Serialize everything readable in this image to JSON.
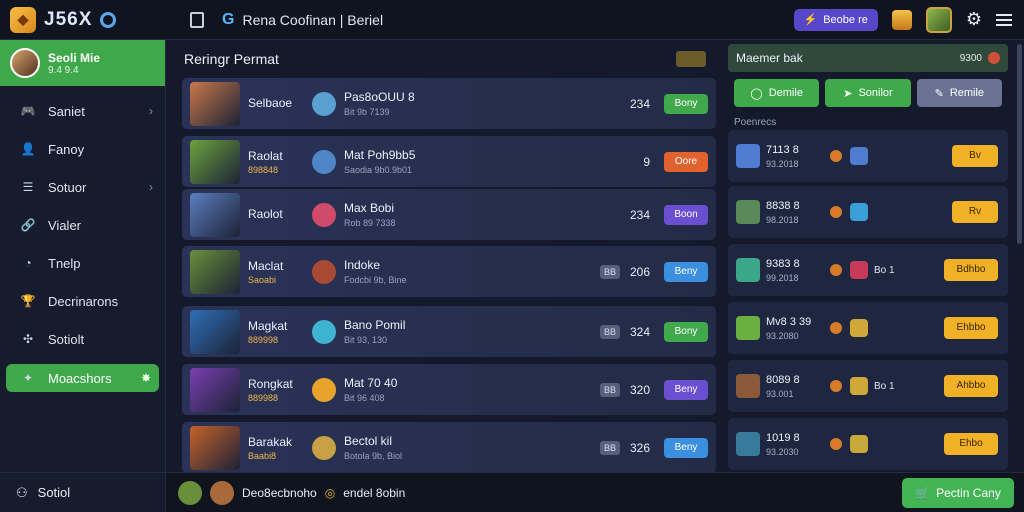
{
  "app": {
    "logo_text": "J56X",
    "breadcrumb": "Rena Coofinan | Beriel"
  },
  "topbar": {
    "promo_label": "Beobe re"
  },
  "profile": {
    "name": "Seoli Mie",
    "sub": "9.4 9.4"
  },
  "sidebar": {
    "items": [
      {
        "label": "Saniet",
        "icon": "controller-icon",
        "chevron": true
      },
      {
        "label": "Fanoy",
        "icon": "user-icon",
        "chevron": false
      },
      {
        "label": "Sotuor",
        "icon": "list-icon",
        "chevron": true
      },
      {
        "label": "Vialer",
        "icon": "link-icon",
        "chevron": false
      },
      {
        "label": "Tnelp",
        "icon": "clock-icon",
        "chevron": false
      },
      {
        "label": "Decrinarons",
        "icon": "trophy-icon",
        "chevron": false
      },
      {
        "label": "Sotiolt",
        "icon": "target-icon",
        "chevron": false
      },
      {
        "label": "Moacshors",
        "icon": "sparkle-icon",
        "chevron": false,
        "active": true
      }
    ],
    "bottom_label": "Sotiol"
  },
  "main": {
    "title": "Reringr Permat",
    "rows": [
      {
        "name": "Selbaoe",
        "tag": "",
        "desc": "Pas8oOUU 8",
        "desc_sub": "Bit 9b 7139",
        "num": "234",
        "btn": "Bony",
        "btn_color": "#3fa94c",
        "av1": "#c9784a",
        "av2": "#5aa0d0",
        "cb": ""
      },
      {
        "name": "Raolat",
        "tag": "898848",
        "desc": "Mat Poh9bb5",
        "desc_sub": "Saodia 9b0.9b01",
        "num": "9",
        "btn": "Oore",
        "btn_color": "#e0622e",
        "av1": "#6ba23c",
        "av2": "#4e86c8",
        "cb": ""
      },
      {
        "name": "Raolot",
        "tag": "",
        "desc": "Max Bobi",
        "desc_sub": "Rob 89 7338",
        "num": "234",
        "btn": "Boon",
        "btn_color": "#6a4fd0",
        "av1": "#5b7fc0",
        "av2": "#d04a6a",
        "cb": ""
      },
      {
        "name": "Maclat",
        "tag": "Saoabi",
        "desc": "Indoke",
        "desc_sub": "Fodcbi 9b, Bine",
        "num": "206",
        "btn": "Beny",
        "btn_color": "#3a8fe0",
        "av1": "#6a8f3a",
        "av2": "#a84a34",
        "cb": "BB"
      },
      {
        "name": "Magkat",
        "tag": "889998",
        "desc": "Bano Pomil",
        "desc_sub": "Bit 93, 130",
        "num": "324",
        "btn": "Bony",
        "btn_color": "#3fa94c",
        "av1": "#2f6fb8",
        "av2": "#3fb4d0",
        "cb": "BB"
      },
      {
        "name": "Rongkat",
        "tag": "889988",
        "desc": "Mat 70 40",
        "desc_sub": "Bit 96 408",
        "num": "320",
        "btn": "Beny",
        "btn_color": "#6a4fd0",
        "av1": "#7a3fb0",
        "av2": "#e8a42a",
        "cb": "BB"
      },
      {
        "name": "Barakak",
        "tag": "Baabi8",
        "desc": "Bectol kil",
        "desc_sub": "Botola 9b, Biol",
        "num": "326",
        "btn": "Beny",
        "btn_color": "#3a8fe0",
        "av1": "#c4622a",
        "av2": "#c8a046",
        "cb": "BB"
      }
    ]
  },
  "right_panel": {
    "title": "Maemer bak",
    "points": "9300",
    "tabs": [
      {
        "label": "Demile",
        "icon": "circle-icon",
        "color": "#3fa94c"
      },
      {
        "label": "Sonilor",
        "icon": "send-icon",
        "color": "#3fa94c"
      },
      {
        "label": "Remile",
        "icon": "pen-icon",
        "color": "#6a7393"
      }
    ],
    "section_label": "Poenrecs",
    "rows": [
      {
        "title": "7113 8",
        "sub": "93.2018",
        "extra": "",
        "btn": "Bv",
        "gem": "#4f7bd0",
        "av": "#4f7bd0"
      },
      {
        "title": "8838 8",
        "sub": "98.2018",
        "extra": "",
        "btn": "Rv",
        "gem": "#3a9fd8",
        "av": "#5a8a58"
      },
      {
        "title": "9383 8",
        "sub": "99.2018",
        "extra": "Bo 1",
        "btn": "Bdhbo",
        "gem": "#c83a5a",
        "av": "#3aa888"
      },
      {
        "title": "Mv8 3 39",
        "sub": "93.2080",
        "extra": "",
        "btn": "Ehbbo",
        "gem": "#d0a83a",
        "av": "#6ab040"
      },
      {
        "title": "8089 8",
        "sub": "93.001",
        "extra": "Bo 1",
        "btn": "Ahbbo",
        "gem": "#d0a83a",
        "av": "#8a5a3a"
      },
      {
        "title": "1019 8",
        "sub": "93.2030",
        "extra": "",
        "btn": "Ehbo",
        "gem": "#c8a83a",
        "av": "#3a7a9a"
      }
    ]
  },
  "bottombar": {
    "label": "Deo8ecbnoho",
    "label2": "endel 8obin",
    "cta": "Pectin Cany"
  }
}
